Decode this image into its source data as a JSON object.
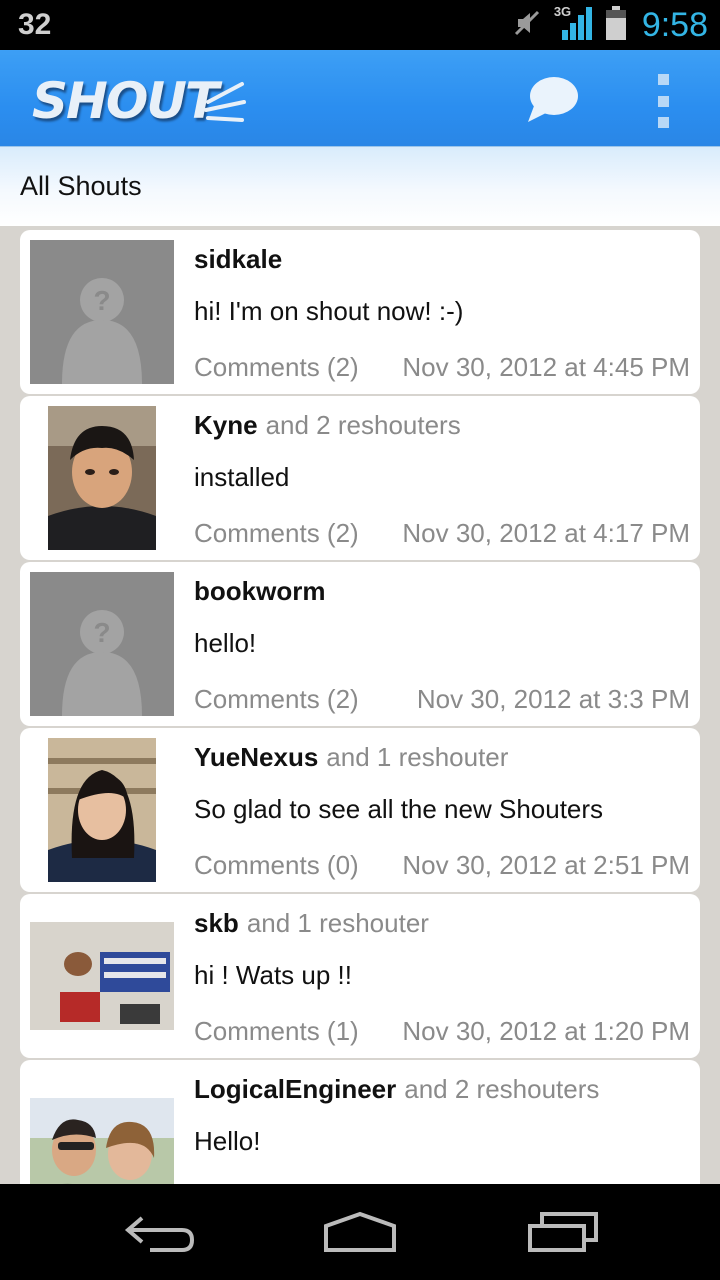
{
  "status_bar": {
    "left_text": "32",
    "network": "3G",
    "time": "9:58"
  },
  "app": {
    "logo_text": "SHOUT"
  },
  "filter": {
    "label": "All Shouts"
  },
  "shouts": [
    {
      "user": "sidkale",
      "reshouters": "",
      "message": "hi! I'm on shout now! :-)",
      "comments": "Comments (2)",
      "date": "Nov 30, 2012 at 4:45 PM",
      "avatar": "default"
    },
    {
      "user": "Kyne",
      "reshouters": "and 2 reshouters",
      "message": "installed",
      "comments": "Comments (2)",
      "date": "Nov 30, 2012 at 4:17 PM",
      "avatar": "photo"
    },
    {
      "user": "bookworm",
      "reshouters": "",
      "message": "hello!",
      "comments": "Comments (2)",
      "date": "Nov 30, 2012 at 3:3 PM",
      "avatar": "default"
    },
    {
      "user": "YueNexus",
      "reshouters": "and 1 reshouter",
      "message": "So glad to see all the new Shouters",
      "comments": "Comments (0)",
      "date": "Nov 30, 2012 at 2:51 PM",
      "avatar": "photo"
    },
    {
      "user": "skb",
      "reshouters": "and 1 reshouter",
      "message": "hi ! Wats up !!",
      "comments": "Comments (1)",
      "date": "Nov 30, 2012 at 1:20 PM",
      "avatar": "photo"
    },
    {
      "user": "LogicalEngineer",
      "reshouters": "and 2 reshouters",
      "message": "Hello!",
      "comments": "",
      "date": "",
      "avatar": "photo"
    }
  ],
  "colors": {
    "accent": "#33b5e5",
    "actionbar": "#2b8ef0",
    "muted_text": "#8a8a8a"
  },
  "icons": [
    "mute-icon",
    "signal-icon",
    "battery-icon",
    "chat-bubble-icon",
    "overflow-menu-icon",
    "back-icon",
    "home-icon",
    "recent-apps-icon"
  ]
}
